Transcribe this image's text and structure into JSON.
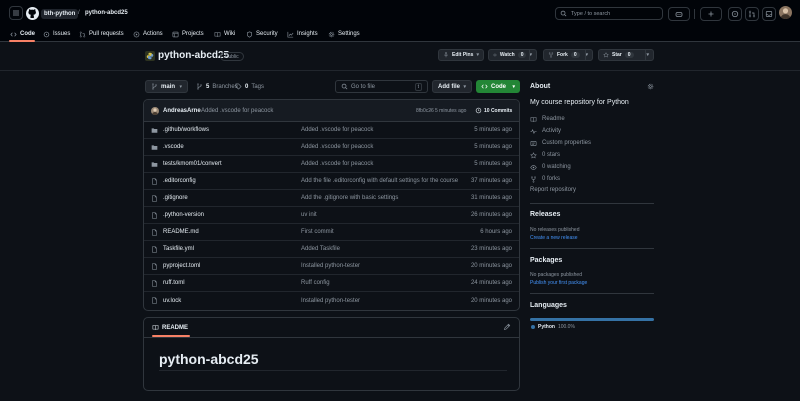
{
  "header": {
    "org": "bth-python",
    "separator": "/",
    "repo": "python-abcd25",
    "search_placeholder": "Type / to search",
    "nav_tabs": [
      "Code",
      "Issues",
      "Pull requests",
      "Actions",
      "Projects",
      "Wiki",
      "Security",
      "Insights",
      "Settings"
    ]
  },
  "repo": {
    "name": "python-abcd25",
    "visibility": "Public",
    "edit_pins": "Edit Pins",
    "watch_label": "Watch",
    "watch_count": "0",
    "fork_label": "Fork",
    "fork_count": "0",
    "star_label": "Star",
    "star_count": "0"
  },
  "toolbar": {
    "branch": "main",
    "branches_count": "5",
    "branches_label": "Branches",
    "tags_count": "0",
    "tags_label": "Tags",
    "goto_placeholder": "Go to file",
    "goto_shortcut": "t",
    "add_file": "Add file",
    "code_button": "Code"
  },
  "commit": {
    "author": "AndreasArne",
    "message": "Added .vscode for peacock",
    "sha": "8fb0c26",
    "age": "5 minutes ago",
    "commits": "10 Commits"
  },
  "files": [
    {
      "type": "dir",
      "name": ".github/workflows",
      "msg": "Added .vscode for peacock",
      "age": "5 minutes ago"
    },
    {
      "type": "dir",
      "name": ".vscode",
      "msg": "Added .vscode for peacock",
      "age": "5 minutes ago"
    },
    {
      "type": "dir",
      "name": "tests/kmom01/convert",
      "msg": "Added .vscode for peacock",
      "age": "5 minutes ago"
    },
    {
      "type": "file",
      "name": ".editorconfig",
      "msg": "Add the file .editorconfig with default settings for the course",
      "age": "37 minutes ago"
    },
    {
      "type": "file",
      "name": ".gitignore",
      "msg": "Add the .gitignore with basic settings",
      "age": "31 minutes ago"
    },
    {
      "type": "file",
      "name": ".python-version",
      "msg": "uv init",
      "age": "26 minutes ago"
    },
    {
      "type": "file",
      "name": "README.md",
      "msg": "First commit",
      "age": "6 hours ago"
    },
    {
      "type": "file",
      "name": "Taskfile.yml",
      "msg": "Added Taskfile",
      "age": "23 minutes ago"
    },
    {
      "type": "file",
      "name": "pyproject.toml",
      "msg": "Installed python-tester",
      "age": "20 minutes ago"
    },
    {
      "type": "file",
      "name": "ruff.toml",
      "msg": "Ruff config",
      "age": "24 minutes ago"
    },
    {
      "type": "file",
      "name": "uv.lock",
      "msg": "Installed python-tester",
      "age": "20 minutes ago"
    }
  ],
  "readme": {
    "tab": "README",
    "heading": "python-abcd25"
  },
  "about": {
    "title": "About",
    "description": "My course repository for Python",
    "readme": "Readme",
    "activity": "Activity",
    "custom_properties": "Custom properties",
    "stars": "0 stars",
    "watching": "0 watching",
    "forks": "0 forks",
    "report": "Report repository"
  },
  "releases": {
    "title": "Releases",
    "none": "No releases published",
    "create": "Create a new release"
  },
  "packages": {
    "title": "Packages",
    "none": "No packages published",
    "publish": "Publish your first package"
  },
  "languages": {
    "title": "Languages",
    "name": "Python",
    "percent": "100.0%",
    "fraction": 1.0,
    "color": "#3572A5"
  },
  "colors": {
    "accent_green": "#238636",
    "link_blue": "#4493f8",
    "active_tab_underline": "#f78166"
  }
}
